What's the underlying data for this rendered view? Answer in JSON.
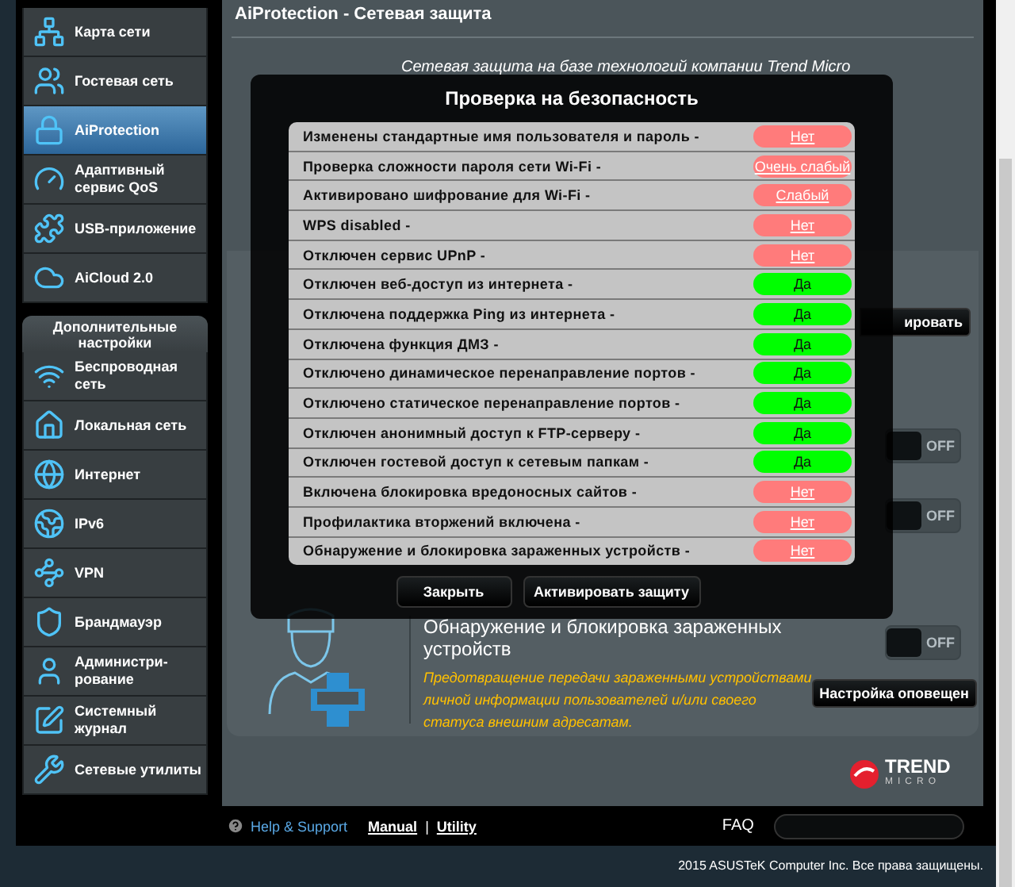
{
  "sidebar": {
    "items": [
      {
        "label": "Карта сети",
        "selected": false
      },
      {
        "label": "Гостевая сеть",
        "selected": false
      },
      {
        "label": "AiProtection",
        "selected": true
      },
      {
        "label": "Адаптивный сервис QoS",
        "selected": false
      },
      {
        "label": "USB-приложение",
        "selected": false
      },
      {
        "label": "AiCloud 2.0",
        "selected": false
      }
    ],
    "section_title": "Дополнительные настройки",
    "advanced_items": [
      {
        "label": "Беспроводная сеть",
        "selected": false
      },
      {
        "label": "Локальная сеть",
        "selected": false
      },
      {
        "label": "Интернет",
        "selected": false
      },
      {
        "label": "IPv6",
        "selected": false
      },
      {
        "label": "VPN",
        "selected": false
      },
      {
        "label": "Брандмауэр",
        "selected": false
      },
      {
        "label": "Администри-рование",
        "selected": false
      },
      {
        "label": "Системный журнал",
        "selected": false
      },
      {
        "label": "Сетевые утилиты",
        "selected": false
      }
    ]
  },
  "page": {
    "title": "AiProtection - Сетевая защита",
    "intro": "Сетевая защита на базе технологий компании Trend Micro"
  },
  "features": [
    {
      "kind": "button",
      "button": "ировать"
    },
    {
      "kind": "toggle",
      "on": false,
      "toggle_label": "OFF"
    },
    {
      "kind": "toggle",
      "on": false,
      "toggle_label": "OFF"
    },
    {
      "kind": "full",
      "title": "Обнаружение и блокировка зараженных устройств",
      "description": "Предотвращение передачи зараженными устройствами личной информации пользователей и/или своего статуса внешним адресатам.",
      "on": false,
      "toggle_label": "OFF",
      "button": "Настройка оповещен"
    }
  ],
  "dialog": {
    "title": "Проверка на безопасность",
    "checks": [
      {
        "label": "Изменены стандартные имя пользователя и пароль -",
        "result": "Нет",
        "passed": false
      },
      {
        "label": "Проверка сложности пароля сети Wi-Fi -",
        "result": "Очень слабый",
        "passed": false
      },
      {
        "label": "Активировано шифрование для Wi-Fi -",
        "result": "Слабый",
        "passed": false
      },
      {
        "label": "WPS disabled -",
        "result": "Нет",
        "passed": false
      },
      {
        "label": "Отключен сервис UPnP -",
        "result": "Нет",
        "passed": false
      },
      {
        "label": "Отключен веб-доступ из интернета -",
        "result": "Да",
        "passed": true
      },
      {
        "label": "Отключена поддержка Ping из интернета -",
        "result": "Да",
        "passed": true
      },
      {
        "label": "Отключена функция ДМЗ -",
        "result": "Да",
        "passed": true
      },
      {
        "label": "Отключено динамическое перенаправление портов -",
        "result": "Да",
        "passed": true
      },
      {
        "label": "Отключено статическое перенаправление портов -",
        "result": "Да",
        "passed": true
      },
      {
        "label": "Отключен анонимный доступ к FTP-серверу -",
        "result": "Да",
        "passed": true
      },
      {
        "label": "Отключен гостевой доступ к сетевым папкам -",
        "result": "Да",
        "passed": true
      },
      {
        "label": "Включена блокировка вредоносных сайтов -",
        "result": "Нет",
        "passed": false
      },
      {
        "label": "Профилактика вторжений включена -",
        "result": "Нет",
        "passed": false
      },
      {
        "label": "Обнаружение и блокировка зараженных устройств -",
        "result": "Нет",
        "passed": false
      }
    ],
    "buttons": [
      "Закрыть",
      "Активировать защиту"
    ]
  },
  "logo": {
    "word1": "TREND",
    "word2": "MICRO"
  },
  "footer": {
    "help": "Help & Support",
    "links": [
      "Manual",
      "Utility"
    ],
    "separator": "|",
    "faq": "FAQ"
  },
  "copyright": "2015 ASUSTeK Computer Inc. Все права защищены."
}
